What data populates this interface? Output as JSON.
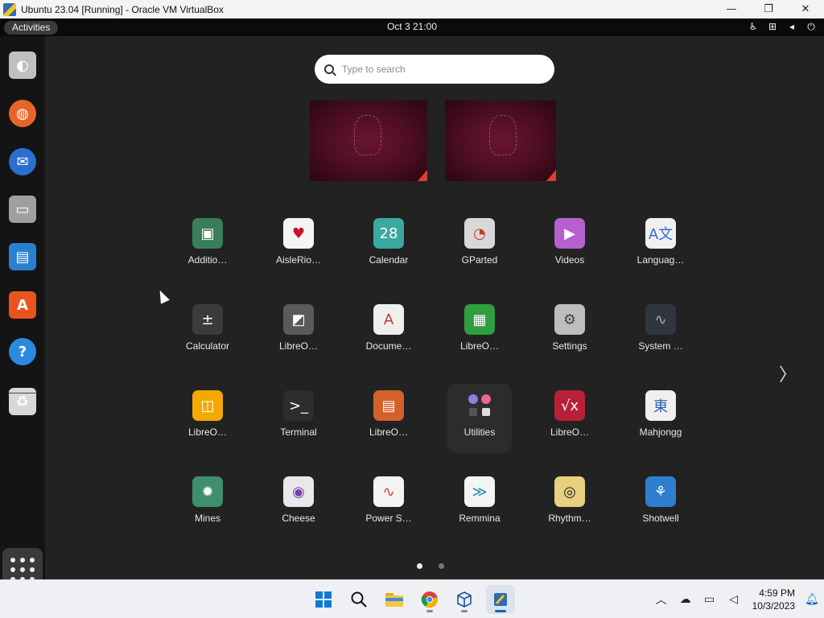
{
  "window": {
    "title": "Ubuntu 23.04 [Running] - Oracle VM VirtualBox",
    "controls": {
      "minimize": "—",
      "restore": "❐",
      "close": "✕"
    }
  },
  "topbar": {
    "activities": "Activities",
    "clock": "Oct 3  21:00"
  },
  "search": {
    "placeholder": "Type to search"
  },
  "apps": [
    {
      "label": "Additio…",
      "icon": "chip-icon",
      "glyph": "▣",
      "bg": "#3a7d5a"
    },
    {
      "label": "AisleRio…",
      "icon": "cards-icon",
      "glyph": "♥",
      "bg": "#f4f4f4",
      "fg": "#c8102e"
    },
    {
      "label": "Calendar",
      "icon": "calendar-icon",
      "glyph": "28",
      "bg": "#3aa9a0"
    },
    {
      "label": "GParted",
      "icon": "gparted-icon",
      "glyph": "◔",
      "bg": "#d8d8d8",
      "fg": "#c0392b"
    },
    {
      "label": "Videos",
      "icon": "videos-icon",
      "glyph": "▶",
      "bg": "#b65fcf"
    },
    {
      "label": "Languag…",
      "icon": "language-icon",
      "glyph": "A文",
      "bg": "#f0f0f0",
      "fg": "#2f6fd1"
    },
    {
      "label": "Calculator",
      "icon": "calculator-icon",
      "glyph": "±",
      "bg": "#3b3b3b",
      "accent": "#f5a623"
    },
    {
      "label": "LibreO…",
      "icon": "libreoffice-icon",
      "glyph": "◩",
      "bg": "#5a5a5a"
    },
    {
      "label": "Docume…",
      "icon": "document-viewer-icon",
      "glyph": "A",
      "bg": "#efefef",
      "fg": "#c0392b"
    },
    {
      "label": "LibreO…",
      "icon": "libreoffice-calc-icon",
      "glyph": "▦",
      "bg": "#2e9e3e"
    },
    {
      "label": "Settings",
      "icon": "settings-icon",
      "glyph": "⚙",
      "bg": "#bdbdbd",
      "fg": "#444"
    },
    {
      "label": "System …",
      "icon": "system-monitor-icon",
      "glyph": "∿",
      "bg": "#2f3640",
      "fg": "#aaa"
    },
    {
      "label": "LibreO…",
      "icon": "libreoffice-draw-icon",
      "glyph": "◫",
      "bg": "#f2a900"
    },
    {
      "label": "Terminal",
      "icon": "terminal-icon",
      "glyph": ">_",
      "bg": "#2d2d2d"
    },
    {
      "label": "LibreO…",
      "icon": "libreoffice-impress-icon",
      "glyph": "▤",
      "bg": "#d4602a"
    },
    {
      "label": "Utilities",
      "icon": "utilities-folder-icon",
      "glyph": "⁘",
      "bg": "transparent",
      "hover": true
    },
    {
      "label": "LibreO…",
      "icon": "libreoffice-math-icon",
      "glyph": "√x",
      "bg": "#b8203a"
    },
    {
      "label": "Mahjongg",
      "icon": "mahjongg-icon",
      "glyph": "東",
      "bg": "#f0f0f0",
      "fg": "#2f5fb0"
    },
    {
      "label": "Mines",
      "icon": "mines-icon",
      "glyph": "✹",
      "bg": "#3e8f6d"
    },
    {
      "label": "Cheese",
      "icon": "cheese-icon",
      "glyph": "◉",
      "bg": "#e8e8e8",
      "fg": "#7a3fb0"
    },
    {
      "label": "Power S…",
      "icon": "power-statistics-icon",
      "glyph": "∿",
      "bg": "#f4f4f4",
      "fg": "#d04040"
    },
    {
      "label": "Remmina",
      "icon": "remmina-icon",
      "glyph": "≫",
      "bg": "#f4f4f4",
      "fg": "#2a8ac8"
    },
    {
      "label": "Rhythm…",
      "icon": "rhythmbox-icon",
      "glyph": "◎",
      "bg": "#e8d080",
      "fg": "#222"
    },
    {
      "label": "Shotwell",
      "icon": "shotwell-icon",
      "glyph": "⚘",
      "bg": "#2f7fd0"
    }
  ],
  "dock": [
    {
      "name": "help-about-icon",
      "glyph": "◐",
      "bg": "#c0c0c0"
    },
    {
      "name": "firefox-icon",
      "glyph": "◍",
      "bg": "#e8652a"
    },
    {
      "name": "thunderbird-icon",
      "glyph": "✉",
      "bg": "#2a6fd0"
    },
    {
      "name": "files-icon",
      "glyph": "▭",
      "bg": "#a0a0a0"
    },
    {
      "name": "libreoffice-writer-icon",
      "glyph": "▤",
      "bg": "#2a7fd0"
    },
    {
      "name": "app-center-icon",
      "glyph": "A",
      "bg": "#e9541e"
    },
    {
      "name": "help-icon",
      "glyph": "?",
      "bg": "#2a8ae0"
    },
    {
      "name": "trash-icon",
      "glyph": "♻",
      "bg": "#d8d8d8"
    }
  ],
  "taskbar": {
    "time": "4:59 PM",
    "date": "10/3/2023"
  }
}
